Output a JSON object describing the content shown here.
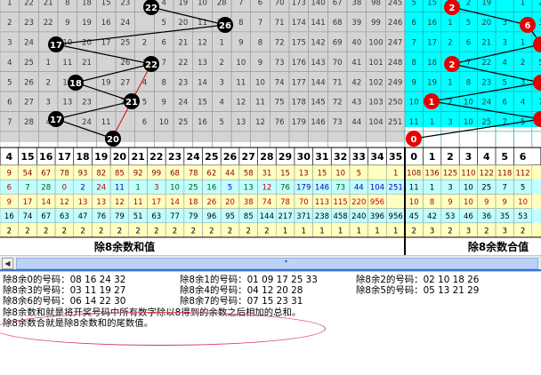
{
  "left_grid": {
    "rows": [
      [
        "1",
        "22",
        "21",
        "8",
        "18",
        "15",
        "23",
        "",
        "4",
        "19",
        "10",
        "28",
        "7",
        "6",
        "70",
        "173",
        "140",
        "67",
        "38",
        "98",
        "245"
      ],
      [
        "2",
        "23",
        "22",
        "9",
        "19",
        "16",
        "24",
        "",
        "5",
        "20",
        "11",
        "29",
        "8",
        "7",
        "71",
        "174",
        "141",
        "68",
        "39",
        "99",
        "246"
      ],
      [
        "3",
        "24",
        "",
        "10",
        "20",
        "17",
        "25",
        "2",
        "6",
        "21",
        "12",
        "1",
        "9",
        "8",
        "72",
        "175",
        "142",
        "69",
        "40",
        "100",
        "247"
      ],
      [
        "4",
        "25",
        "1",
        "11",
        "21",
        "",
        "26",
        "3",
        "7",
        "22",
        "13",
        "2",
        "10",
        "9",
        "73",
        "176",
        "143",
        "70",
        "41",
        "101",
        "248"
      ],
      [
        "5",
        "26",
        "2",
        "12",
        "",
        "19",
        "27",
        "4",
        "8",
        "23",
        "14",
        "3",
        "11",
        "10",
        "74",
        "177",
        "144",
        "71",
        "42",
        "102",
        "249"
      ],
      [
        "6",
        "27",
        "3",
        "13",
        "23",
        "",
        "28",
        "5",
        "9",
        "24",
        "15",
        "4",
        "12",
        "11",
        "75",
        "178",
        "145",
        "72",
        "43",
        "103",
        "250"
      ],
      [
        "7",
        "28",
        "4",
        "",
        "24",
        "11",
        "",
        "6",
        "10",
        "25",
        "16",
        "5",
        "13",
        "12",
        "76",
        "179",
        "146",
        "73",
        "44",
        "104",
        "251"
      ],
      [
        "",
        "",
        "",
        "",
        "",
        "",
        "",
        "",
        "",
        "",
        "",
        "",
        "",
        "",
        "",
        "",
        "",
        "",
        "",
        "",
        ""
      ]
    ],
    "draws": [
      "22",
      "26",
      "17",
      "22",
      "18",
      "21",
      "17",
      "20"
    ],
    "header": [
      "4",
      "15",
      "16",
      "17",
      "18",
      "19",
      "20",
      "21",
      "22",
      "23",
      "24",
      "25",
      "26",
      "27",
      "28",
      "29",
      "30",
      "31",
      "32",
      "33",
      "34",
      "35"
    ],
    "stats": [
      [
        "9",
        "54",
        "67",
        "78",
        "93",
        "82",
        "85",
        "92",
        "99",
        "68",
        "78",
        "62",
        "44",
        "58",
        "31",
        "15",
        "13",
        "15",
        "10",
        "5",
        "",
        "1"
      ],
      [
        "6",
        "7",
        "28",
        "0",
        "2",
        "24",
        "11",
        "1",
        "3",
        "10",
        "25",
        "16",
        "5",
        "13",
        "12",
        "76",
        "179",
        "146",
        "73",
        "44",
        "104",
        "251"
      ],
      [
        "9",
        "17",
        "14",
        "12",
        "13",
        "13",
        "12",
        "11",
        "17",
        "14",
        "18",
        "26",
        "20",
        "38",
        "74",
        "78",
        "70",
        "113",
        "115",
        "220",
        "956",
        ""
      ],
      [
        "16",
        "74",
        "67",
        "63",
        "47",
        "76",
        "79",
        "51",
        "63",
        "77",
        "79",
        "96",
        "95",
        "85",
        "144",
        "217",
        "371",
        "238",
        "458",
        "240",
        "396",
        "956"
      ],
      [
        "2",
        "2",
        "2",
        "2",
        "2",
        "2",
        "2",
        "2",
        "2",
        "2",
        "2",
        "2",
        "2",
        "2",
        "2",
        "1",
        "1",
        "1",
        "1",
        "1",
        "1",
        "1"
      ]
    ],
    "footer_label": "除8余数和值"
  },
  "right_grid": {
    "rows": [
      [
        "5",
        "15",
        "",
        "2",
        "19",
        "",
        "1",
        "2"
      ],
      [
        "6",
        "16",
        "1",
        "5",
        "20",
        "3",
        "",
        "3"
      ],
      [
        "7",
        "17",
        "2",
        "6",
        "21",
        "3",
        "1",
        ""
      ],
      [
        "8",
        "18",
        "",
        "7",
        "22",
        "4",
        "2",
        "5"
      ],
      [
        "9",
        "19",
        "1",
        "8",
        "23",
        "5",
        "3",
        "6"
      ],
      [
        "10",
        "",
        "2",
        "10",
        "24",
        "6",
        "4",
        "7"
      ],
      [
        "11",
        "1",
        "3",
        "10",
        "25",
        "7",
        "5",
        ""
      ],
      [
        "",
        "",
        "",
        "",
        "",
        "",
        "",
        ""
      ]
    ],
    "draws": [
      "2",
      "6",
      "",
      "2",
      "",
      "1",
      "",
      "0"
    ],
    "header": [
      "0",
      "1",
      "2",
      "3",
      "4",
      "5",
      "6"
    ],
    "stats": [
      [
        "108",
        "136",
        "125",
        "110",
        "122",
        "118",
        "112"
      ],
      [
        "11",
        "1",
        "3",
        "10",
        "25",
        "7",
        "5"
      ],
      [
        "10",
        "8",
        "9",
        "10",
        "9",
        "9",
        "10"
      ],
      [
        "45",
        "42",
        "53",
        "46",
        "36",
        "35",
        "53"
      ],
      [
        "2",
        "3",
        "2",
        "3",
        "2",
        "3",
        "2"
      ]
    ],
    "footer_label": "除8余数合值"
  },
  "remainder_groups": [
    {
      "label": "除8余0的号码：08 16 24 32"
    },
    {
      "label": "除8余1的号码：01 09 17 25 33"
    },
    {
      "label": "除8余2的号码：02 10 18 26"
    },
    {
      "label": "除8余3的号码：03 11 19 27"
    },
    {
      "label": "除8余4的号码：04 12 20 28"
    },
    {
      "label": "除8余5的号码：05 13 21 29"
    },
    {
      "label": "除8余6的号码：06 14 22 30"
    },
    {
      "label": "除8余7的号码：07 15 23 31"
    }
  ],
  "definitions": [
    "除8余数和就是将开奖号码中所有数字除以8得到的余数之后相加的总和。",
    "除8余数合就是除8余数和的尾数值。"
  ],
  "colors": {
    "grid_gray": "#d4d4d4",
    "grid_cyan": "#00ffff",
    "ball_black": "#000000",
    "ball_red": "#e60000",
    "annotation_line": "#e00000",
    "highlight_oval": "#d6405a",
    "stat_yellow": "#ffffc0",
    "stat_cyan": "#c0ffff"
  },
  "scrollbar": {
    "left_arrow": "◀",
    "grip": "▾"
  }
}
